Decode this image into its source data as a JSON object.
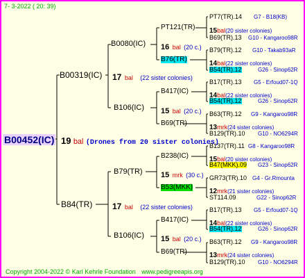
{
  "header": {
    "date": "7-  3-2022 ( 20: 39)"
  },
  "footer": {
    "copyright": "Copyright 2004-2022 © Karl Kehrle Foundation",
    "site": "www.pedigreeapis.org"
  },
  "root": {
    "id": "B00452(IC)",
    "count": "19",
    "mark": "bal",
    "note": "(Drones from 20 sister colonies)"
  },
  "gen1": [
    {
      "id": "B00319(IC)",
      "count": "17",
      "mark": "bal",
      "note": "(22 sister colonies)"
    },
    {
      "id": "B84(TR)",
      "count": "17",
      "mark": "bal",
      "note": "(22 sister colonies)"
    }
  ],
  "gen2": [
    {
      "id": "B0080(IC)",
      "count": "16",
      "mark": "bal",
      "note": "(20 c.)"
    },
    {
      "id": "B106(IC)",
      "count": "15",
      "mark": "bal",
      "note": "(20 c.)"
    },
    {
      "id": "B79(TR)",
      "count": "15",
      "mark": "mrk",
      "note": "(30 c.)"
    },
    {
      "id": "B106(IC)",
      "count": "15",
      "mark": "bal",
      "note": "(20 c.)"
    }
  ],
  "gen3": [
    {
      "id": "PT121(TR)",
      "count": "15",
      "mark": "bal",
      "note": "(20 sister colonies)"
    },
    {
      "id": "B76(TR)",
      "count": "14",
      "mark": "bal",
      "note": "(22 sister colonies)"
    },
    {
      "id": "B417(IC)",
      "count": "14",
      "mark": "bal",
      "note": "(22 sister colonies)"
    },
    {
      "id": "B69(TR)",
      "count": "13",
      "mark": "mrk",
      "note": "(24 sister colonies)"
    },
    {
      "id": "B238(IC)",
      "count": "15",
      "mark": "bal",
      "note": "(20 sister colonies)"
    },
    {
      "id": "B53(MKK)",
      "count": "12",
      "mark": "mrk",
      "note": "(21 sister colonies)"
    },
    {
      "id": "B417(IC)",
      "count": "14",
      "mark": "bal",
      "note": "(22 sister colonies)"
    },
    {
      "id": "B69(TR)",
      "count": "13",
      "mark": "mrk",
      "note": "(24 sister colonies)"
    }
  ],
  "gen4": [
    {
      "id": "PT7(TR).14",
      "info": "G7 - B18(KB)"
    },
    {
      "id": "B69(TR).13",
      "info": "G10 - Kangaroo98R"
    },
    {
      "id": "B79(TR).12",
      "info": "G10 - Takab93aR"
    },
    {
      "id": "B54(TR).12",
      "info": "G26 - Sinop62R"
    },
    {
      "id": "B17(TR).13",
      "info": "G5 - Erfoud07-1Q"
    },
    {
      "id": "B54(TR).12",
      "info": "G26 - Sinop62R"
    },
    {
      "id": "B63(TR).12",
      "info": "G9 - Kangaroo98R"
    },
    {
      "id": "B129(TR).10",
      "info": "G10 - NO6294R"
    },
    {
      "id": "B137(TR).11",
      "info": "G8 - Kangaroo98R"
    },
    {
      "id": "B47(MKK).09",
      "info": "G23 - Sinop62R"
    },
    {
      "id": "GR73(TR).10",
      "info": "G4 - Gr.Rmounta"
    },
    {
      "id": "ST114.09",
      "info": "G22 - Sinop62R"
    },
    {
      "id": "B17(TR).13",
      "info": "G5 - Erfoud07-1Q"
    },
    {
      "id": "B54(TR).12",
      "info": "G26 - Sinop62R"
    },
    {
      "id": "B63(TR).12",
      "info": "G9 - Kangaroo98R"
    },
    {
      "id": "B129(TR).10",
      "info": "G10 - NO6294R"
    }
  ],
  "colors": {
    "border": "#ff00ff",
    "background": "#ffffe6",
    "accent_text": "#0000cc",
    "mark": "#cc0000",
    "cyan_highlight": "#00e5ee",
    "yellow_highlight": "#ffff00",
    "green_highlight": "#00e000"
  }
}
